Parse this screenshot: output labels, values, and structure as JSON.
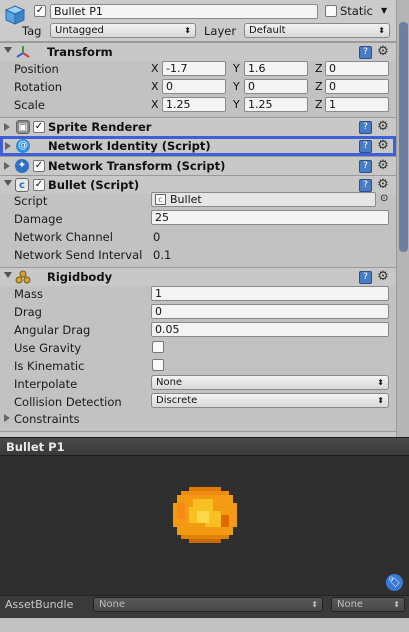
{
  "header": {
    "object_name": "Bullet P1",
    "static_label": "Static",
    "tag_label": "Tag",
    "tag_value": "Untagged",
    "layer_label": "Layer",
    "layer_value": "Default"
  },
  "transform": {
    "title": "Transform",
    "rows": [
      {
        "label": "Position",
        "x": "-1.7",
        "y": "1.6",
        "z": "0"
      },
      {
        "label": "Rotation",
        "x": "0",
        "y": "0",
        "z": "0"
      },
      {
        "label": "Scale",
        "x": "1.25",
        "y": "1.25",
        "z": "1"
      }
    ],
    "axis_x": "X",
    "axis_y": "Y",
    "axis_z": "Z"
  },
  "components": {
    "sprite_renderer": "Sprite Renderer",
    "network_identity": "Network Identity (Script)",
    "network_transform": "Network Transform (Script)",
    "bullet": "Bullet (Script)"
  },
  "bullet_script": {
    "script_label": "Script",
    "script_value": "Bullet",
    "damage_label": "Damage",
    "damage_value": "25",
    "channel_label": "Network Channel",
    "channel_value": "0",
    "interval_label": "Network Send Interval",
    "interval_value": "0.1"
  },
  "rigidbody": {
    "title": "Rigidbody",
    "mass_label": "Mass",
    "mass_value": "1",
    "drag_label": "Drag",
    "drag_value": "0",
    "angular_label": "Angular Drag",
    "angular_value": "0.05",
    "gravity_label": "Use Gravity",
    "kinematic_label": "Is Kinematic",
    "interpolate_label": "Interpolate",
    "interpolate_value": "None",
    "collision_label": "Collision Detection",
    "collision_value": "Discrete",
    "constraints_label": "Constraints"
  },
  "preview": {
    "title": "Bullet P1",
    "assetbundle_label": "AssetBundle",
    "bundle_value": "None",
    "variant_value": "None"
  },
  "colors": {
    "selection": "#3f5fd6",
    "preview_bg": "#2f2f2f",
    "bullet_orange": "#f29a12"
  }
}
